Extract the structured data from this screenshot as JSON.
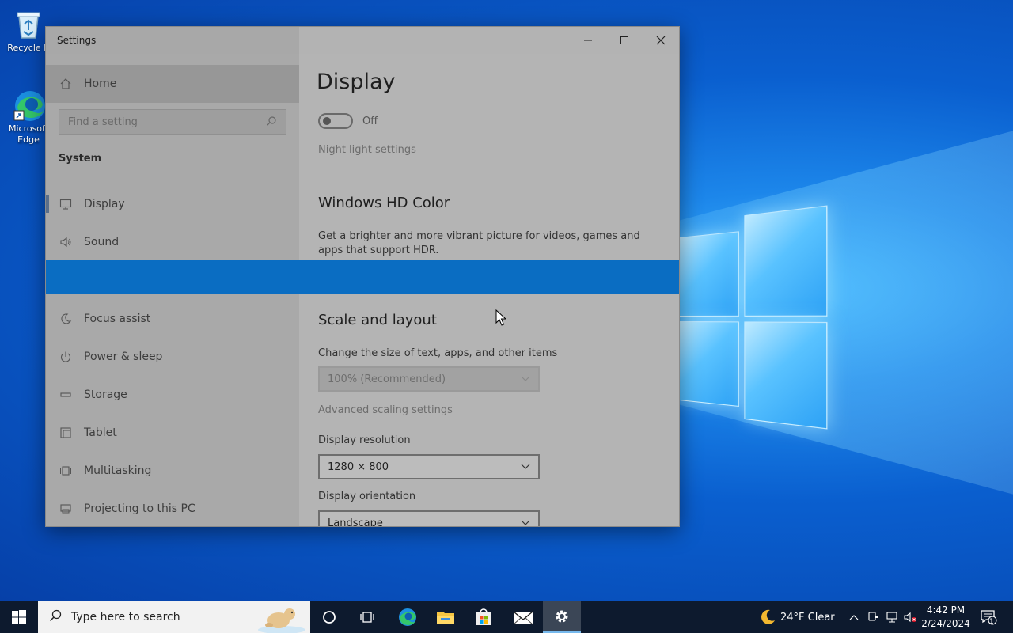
{
  "desktop": {
    "icons": [
      {
        "label": "Recycle B"
      },
      {
        "label": "Microsoft Edge"
      }
    ]
  },
  "window": {
    "title": "Settings",
    "controls": {
      "minimize": "—",
      "maximize": "☐",
      "close": "✕"
    }
  },
  "sidebar": {
    "home": "Home",
    "search_placeholder": "Find a setting",
    "section": "System",
    "items": [
      {
        "label": "Display"
      },
      {
        "label": "Sound"
      },
      {
        "label": "Focus assist"
      },
      {
        "label": "Power & sleep"
      },
      {
        "label": "Storage"
      },
      {
        "label": "Tablet"
      },
      {
        "label": "Multitasking"
      },
      {
        "label": "Projecting to this PC"
      }
    ]
  },
  "content": {
    "title": "Display",
    "night_light_state": "Off",
    "night_light_link": "Night light settings",
    "hd_color_heading": "Windows HD Color",
    "hd_color_text": "Get a brighter and more vibrant picture for videos, games and apps that support HDR.",
    "scale_heading": "Scale and layout",
    "scale_label": "Change the size of text, apps, and other items",
    "scale_value": "100% (Recommended)",
    "advanced_scaling_link": "Advanced scaling settings",
    "resolution_label": "Display resolution",
    "resolution_value": "1280 × 800",
    "orientation_label": "Display orientation",
    "orientation_value": "Landscape"
  },
  "taskbar": {
    "search_placeholder": "Type here to search",
    "weather": "24°F  Clear",
    "time": "4:42 PM",
    "date": "2/24/2024",
    "notification_count": "1"
  },
  "colors": {
    "accent_band": "#0a6dc2",
    "taskbar": "#0d1a2e"
  }
}
